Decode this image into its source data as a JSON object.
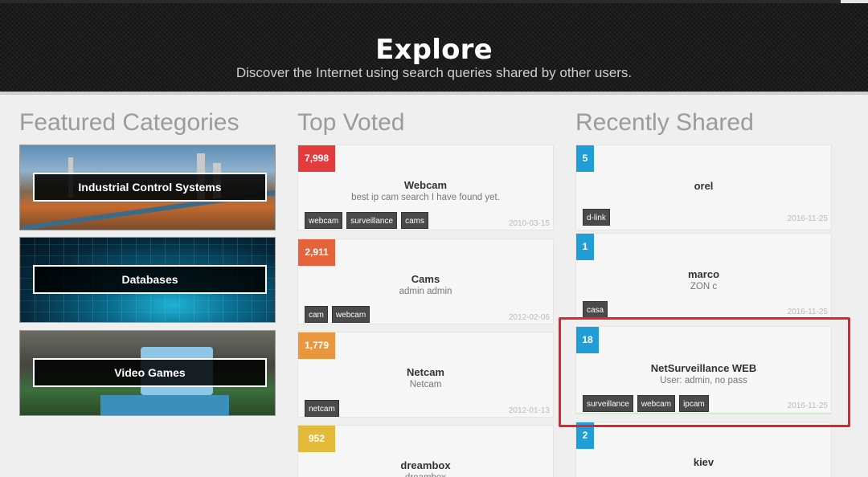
{
  "header": {
    "title": "Explore",
    "subtitle": "Discover the Internet using search queries shared by other users."
  },
  "featured": {
    "title": "Featured Categories",
    "items": [
      {
        "label": "Industrial Control Systems"
      },
      {
        "label": "Databases"
      },
      {
        "label": "Video Games"
      }
    ]
  },
  "top_voted": {
    "title": "Top Voted",
    "items": [
      {
        "votes": "7,998",
        "color": "#e43c3c",
        "title": "Webcam",
        "desc": "best ip cam search I have found yet.",
        "tags": [
          "webcam",
          "surveillance",
          "cams"
        ],
        "date": "2010-03-15"
      },
      {
        "votes": "2,911",
        "color": "#e6623a",
        "title": "Cams",
        "desc": "admin admin",
        "tags": [
          "cam",
          "webcam"
        ],
        "date": "2012-02-06"
      },
      {
        "votes": "1,779",
        "color": "#e8973f",
        "title": "Netcam",
        "desc": "Netcam",
        "tags": [
          "netcam"
        ],
        "date": "2012-01-13"
      },
      {
        "votes": "952",
        "color": "#e4ba3a",
        "title": "dreambox",
        "desc": "dreambox",
        "tags": [],
        "date": ""
      }
    ]
  },
  "recent": {
    "title": "Recently Shared",
    "items": [
      {
        "votes": "5",
        "color": "#1f9ed8",
        "title": "orel",
        "desc": "",
        "tags": [
          "d-link"
        ],
        "date": "2016-11-25"
      },
      {
        "votes": "1",
        "color": "#1f9ed8",
        "title": "marco",
        "desc": "ZON c",
        "tags": [
          "casa"
        ],
        "date": "2016-11-25"
      },
      {
        "votes": "18",
        "color": "#1f9ed8",
        "title": "NetSurveillance WEB",
        "desc": "User: admin, no pass",
        "tags": [
          "surveillance",
          "webcam",
          "ipcam"
        ],
        "date": "2016-11-25"
      },
      {
        "votes": "2",
        "color": "#1f9ed8",
        "title": "kiev",
        "desc": "",
        "tags": [],
        "date": ""
      }
    ]
  }
}
